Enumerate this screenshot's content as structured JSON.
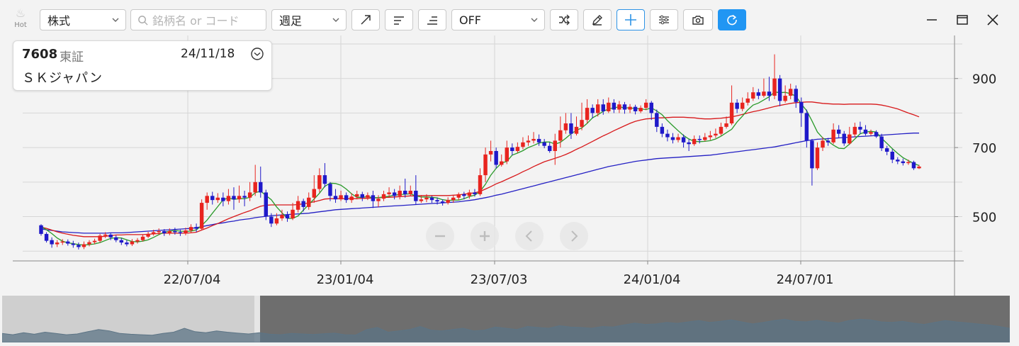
{
  "toolbar": {
    "hot_label": "Hot",
    "market_select": "株式",
    "search_placeholder": "銘柄名 or コード",
    "period_select": "週足",
    "indicator_select": "OFF",
    "icons": [
      "trend-line-icon",
      "horizontal-line-icon",
      "horizontal-line-end-icon",
      "shuffle-icon",
      "pencil-icon",
      "crosshair-plus-icon",
      "settings-sliders-icon",
      "camera-icon",
      "refresh-icon"
    ]
  },
  "window": {
    "controls": [
      "minimize-icon",
      "maximize-icon",
      "close-icon"
    ]
  },
  "info": {
    "code": "7608",
    "market": "東証",
    "date": "24/11/18",
    "name": "ＳＫジャパン"
  },
  "colors": {
    "up": "#e8241f",
    "down": "#1f19c9",
    "ma_short": "#2a9a2a",
    "ma_mid": "#d8191b",
    "ma_long": "#2420c4",
    "active_button": "#2196f3"
  },
  "chart_data": {
    "type": "candlestick",
    "title": "",
    "x_ticks": [
      "22/07/04",
      "23/01/04",
      "23/07/03",
      "24/01/04",
      "24/07/01"
    ],
    "y_ticks": [
      500,
      700,
      900
    ],
    "ylim": [
      380,
      1000
    ],
    "grid": true,
    "candles": [
      [
        475,
        450,
        478,
        445
      ],
      [
        450,
        430,
        455,
        425
      ],
      [
        432,
        420,
        440,
        410
      ],
      [
        420,
        425,
        432,
        412
      ],
      [
        425,
        428,
        435,
        418
      ],
      [
        428,
        422,
        434,
        416
      ],
      [
        422,
        418,
        430,
        410
      ],
      [
        418,
        412,
        425,
        405
      ],
      [
        412,
        420,
        428,
        406
      ],
      [
        420,
        426,
        432,
        414
      ],
      [
        426,
        430,
        436,
        420
      ],
      [
        430,
        445,
        450,
        425
      ],
      [
        445,
        448,
        455,
        438
      ],
      [
        448,
        440,
        452,
        432
      ],
      [
        440,
        432,
        446,
        426
      ],
      [
        432,
        425,
        438,
        418
      ],
      [
        425,
        420,
        432,
        414
      ],
      [
        420,
        428,
        435,
        415
      ],
      [
        428,
        432,
        438,
        422
      ],
      [
        432,
        442,
        448,
        428
      ],
      [
        442,
        450,
        456,
        438
      ],
      [
        450,
        455,
        462,
        445
      ],
      [
        455,
        458,
        466,
        448
      ],
      [
        458,
        452,
        464,
        444
      ],
      [
        452,
        458,
        466,
        446
      ],
      [
        458,
        455,
        468,
        448
      ],
      [
        455,
        452,
        462,
        444
      ],
      [
        452,
        460,
        468,
        446
      ],
      [
        460,
        470,
        478,
        452
      ],
      [
        470,
        465,
        480,
        455
      ],
      [
        465,
        540,
        550,
        460
      ],
      [
        540,
        560,
        570,
        520
      ],
      [
        560,
        548,
        572,
        535
      ],
      [
        548,
        555,
        568,
        540
      ],
      [
        555,
        545,
        570,
        530
      ],
      [
        545,
        560,
        580,
        535
      ],
      [
        560,
        550,
        585,
        520
      ],
      [
        550,
        560,
        590,
        540
      ],
      [
        560,
        555,
        575,
        530
      ],
      [
        555,
        570,
        600,
        545
      ],
      [
        570,
        600,
        650,
        560
      ],
      [
        600,
        570,
        645,
        555
      ],
      [
        570,
        500,
        578,
        490
      ],
      [
        500,
        480,
        510,
        470
      ],
      [
        480,
        495,
        510,
        475
      ],
      [
        495,
        505,
        520,
        488
      ],
      [
        505,
        495,
        515,
        485
      ],
      [
        495,
        520,
        540,
        490
      ],
      [
        520,
        545,
        560,
        512
      ],
      [
        545,
        528,
        552,
        515
      ],
      [
        528,
        555,
        570,
        520
      ],
      [
        555,
        580,
        620,
        540
      ],
      [
        580,
        620,
        640,
        570
      ],
      [
        620,
        595,
        655,
        585
      ],
      [
        595,
        560,
        600,
        545
      ],
      [
        560,
        550,
        580,
        540
      ],
      [
        550,
        562,
        575,
        545
      ],
      [
        562,
        548,
        570,
        540
      ],
      [
        548,
        558,
        568,
        540
      ],
      [
        558,
        565,
        575,
        550
      ],
      [
        565,
        555,
        572,
        545
      ],
      [
        555,
        562,
        570,
        548
      ],
      [
        562,
        545,
        575,
        525
      ],
      [
        545,
        552,
        562,
        528
      ],
      [
        552,
        565,
        575,
        545
      ],
      [
        565,
        570,
        585,
        555
      ],
      [
        570,
        560,
        580,
        550
      ],
      [
        560,
        575,
        590,
        550
      ],
      [
        575,
        565,
        610,
        555
      ],
      [
        565,
        575,
        590,
        560
      ],
      [
        575,
        545,
        620,
        535
      ],
      [
        545,
        550,
        560,
        540
      ],
      [
        550,
        555,
        565,
        542
      ],
      [
        555,
        548,
        560,
        540
      ],
      [
        548,
        544,
        555,
        535
      ],
      [
        544,
        540,
        550,
        532
      ],
      [
        540,
        548,
        556,
        535
      ],
      [
        548,
        555,
        562,
        540
      ],
      [
        555,
        565,
        570,
        548
      ],
      [
        565,
        560,
        572,
        550
      ],
      [
        560,
        570,
        578,
        552
      ],
      [
        570,
        565,
        580,
        558
      ],
      [
        565,
        620,
        640,
        560
      ],
      [
        620,
        680,
        700,
        600
      ],
      [
        680,
        690,
        720,
        660
      ],
      [
        690,
        650,
        700,
        640
      ],
      [
        650,
        660,
        680,
        645
      ],
      [
        660,
        700,
        720,
        652
      ],
      [
        700,
        690,
        712,
        678
      ],
      [
        690,
        702,
        715,
        685
      ],
      [
        702,
        715,
        730,
        695
      ],
      [
        715,
        720,
        735,
        705
      ],
      [
        720,
        725,
        745,
        712
      ],
      [
        725,
        715,
        738,
        705
      ],
      [
        715,
        705,
        725,
        698
      ],
      [
        705,
        690,
        715,
        685
      ],
      [
        690,
        720,
        740,
        650
      ],
      [
        720,
        750,
        790,
        700
      ],
      [
        750,
        770,
        800,
        740
      ],
      [
        770,
        740,
        800,
        725
      ],
      [
        740,
        760,
        790,
        735
      ],
      [
        760,
        780,
        830,
        750
      ],
      [
        780,
        815,
        840,
        770
      ],
      [
        815,
        800,
        825,
        785
      ],
      [
        800,
        825,
        840,
        790
      ],
      [
        825,
        805,
        840,
        795
      ],
      [
        805,
        830,
        845,
        800
      ],
      [
        830,
        810,
        840,
        800
      ],
      [
        810,
        825,
        835,
        800
      ],
      [
        825,
        810,
        832,
        798
      ],
      [
        810,
        818,
        826,
        800
      ],
      [
        818,
        805,
        824,
        796
      ],
      [
        805,
        815,
        822,
        800
      ],
      [
        815,
        830,
        840,
        808
      ],
      [
        830,
        800,
        835,
        780
      ],
      [
        800,
        760,
        810,
        745
      ],
      [
        760,
        740,
        770,
        730
      ],
      [
        740,
        730,
        752,
        718
      ],
      [
        730,
        722,
        742,
        712
      ],
      [
        722,
        730,
        740,
        715
      ],
      [
        730,
        715,
        738,
        700
      ],
      [
        715,
        710,
        724,
        690
      ],
      [
        710,
        725,
        735,
        705
      ],
      [
        725,
        722,
        735,
        712
      ],
      [
        722,
        730,
        742,
        718
      ],
      [
        730,
        735,
        748,
        722
      ],
      [
        735,
        740,
        755,
        728
      ],
      [
        740,
        760,
        772,
        735
      ],
      [
        760,
        770,
        790,
        755
      ],
      [
        770,
        830,
        880,
        765
      ],
      [
        830,
        812,
        840,
        800
      ],
      [
        812,
        830,
        845,
        805
      ],
      [
        830,
        842,
        860,
        822
      ],
      [
        842,
        860,
        875,
        835
      ],
      [
        860,
        850,
        870,
        840
      ],
      [
        850,
        862,
        900,
        845
      ],
      [
        862,
        850,
        905,
        835
      ],
      [
        850,
        900,
        970,
        840
      ],
      [
        900,
        835,
        910,
        820
      ],
      [
        835,
        850,
        880,
        830
      ],
      [
        850,
        870,
        885,
        840
      ],
      [
        870,
        832,
        880,
        815
      ],
      [
        832,
        800,
        845,
        760
      ],
      [
        800,
        720,
        810,
        700
      ],
      [
        720,
        640,
        725,
        590
      ],
      [
        640,
        700,
        715,
        635
      ],
      [
        700,
        720,
        730,
        690
      ],
      [
        720,
        715,
        728,
        705
      ],
      [
        715,
        752,
        770,
        710
      ],
      [
        752,
        740,
        765,
        728
      ],
      [
        740,
        712,
        748,
        705
      ],
      [
        712,
        738,
        760,
        708
      ],
      [
        738,
        760,
        772,
        730
      ],
      [
        760,
        752,
        775,
        740
      ],
      [
        752,
        740,
        765,
        735
      ],
      [
        740,
        745,
        752,
        735
      ],
      [
        745,
        732,
        750,
        728
      ],
      [
        732,
        698,
        740,
        690
      ],
      [
        698,
        688,
        705,
        678
      ],
      [
        688,
        665,
        695,
        655
      ],
      [
        665,
        660,
        672,
        652
      ],
      [
        660,
        655,
        668,
        648
      ],
      [
        655,
        658,
        665,
        650
      ],
      [
        658,
        640,
        662,
        635
      ],
      [
        640,
        645,
        650,
        638
      ]
    ],
    "ma_short": [
      471,
      462,
      451,
      438,
      429,
      424,
      422,
      419,
      418,
      419,
      421,
      425,
      431,
      437,
      439,
      438,
      433,
      428,
      427,
      429,
      433,
      440,
      448,
      455,
      458,
      460,
      458,
      457,
      458,
      462,
      474,
      490,
      510,
      529,
      549,
      554,
      550,
      552,
      552,
      556,
      569,
      574,
      561,
      549,
      528,
      511,
      495,
      495,
      502,
      519,
      535,
      551,
      568,
      588,
      597,
      596,
      591,
      580,
      566,
      556,
      556,
      558,
      555,
      555,
      557,
      559,
      562,
      564,
      565,
      566,
      560,
      557,
      557,
      556,
      554,
      549,
      547,
      548,
      548,
      552,
      558,
      562,
      573,
      594,
      620,
      640,
      655,
      660,
      678,
      684,
      691,
      700,
      706,
      713,
      716,
      716,
      710,
      715,
      727,
      740,
      750,
      757,
      770,
      786,
      795,
      805,
      812,
      815,
      818,
      815,
      815,
      813,
      812,
      810,
      815,
      806,
      795,
      778,
      763,
      749,
      735,
      725,
      718,
      717,
      718,
      720,
      725,
      733,
      743,
      753,
      774,
      791,
      809,
      823,
      829,
      838,
      847,
      861,
      859,
      860,
      856,
      849,
      826,
      807,
      777,
      745,
      728,
      718,
      707,
      698,
      697,
      710,
      725,
      740,
      745,
      747,
      745,
      727,
      712,
      697,
      683,
      671,
      662,
      654,
      648
    ],
    "ma_mid": [
      470,
      466,
      461,
      456,
      452,
      449,
      446,
      444,
      442,
      442,
      442,
      442,
      443,
      445,
      447,
      447,
      448,
      448,
      448,
      448,
      449,
      450,
      451,
      452,
      452,
      452,
      452,
      452,
      453,
      455,
      461,
      467,
      474,
      480,
      487,
      494,
      500,
      506,
      512,
      517,
      524,
      530,
      533,
      534,
      534,
      534,
      534,
      534,
      535,
      537,
      540,
      543,
      547,
      551,
      552,
      552,
      552,
      552,
      552,
      552,
      553,
      553,
      554,
      555,
      556,
      556,
      557,
      558,
      559,
      560,
      560,
      561,
      561,
      561,
      561,
      561,
      561,
      562,
      563,
      565,
      567,
      569,
      573,
      580,
      587,
      595,
      601,
      608,
      615,
      622,
      630,
      637,
      645,
      652,
      659,
      664,
      669,
      674,
      680,
      687,
      695,
      702,
      710,
      718,
      726,
      734,
      741,
      749,
      756,
      763,
      770,
      776,
      780,
      783,
      784,
      786,
      786,
      787,
      788,
      788,
      788,
      787,
      786,
      784,
      783,
      783,
      784,
      785,
      787,
      789,
      792,
      796,
      800,
      804,
      807,
      811,
      815,
      819,
      822,
      825,
      828,
      830,
      831,
      832,
      832,
      830,
      828,
      827,
      826,
      826,
      825,
      826,
      826,
      826,
      826,
      826,
      825,
      823,
      820,
      816,
      812,
      806,
      800,
      795,
      789
    ],
    "ma_long": [
      465,
      462,
      460,
      458,
      456,
      455,
      454,
      453,
      452,
      452,
      452,
      452,
      452,
      453,
      453,
      453,
      454,
      455,
      456,
      457,
      458,
      459,
      460,
      461,
      462,
      463,
      464,
      465,
      466,
      468,
      471,
      474,
      477,
      480,
      482,
      485,
      487,
      490,
      492,
      494,
      497,
      499,
      501,
      503,
      504,
      505,
      506,
      507,
      508,
      509,
      510,
      512,
      514,
      516,
      518,
      520,
      521,
      522,
      523,
      524,
      525,
      526,
      527,
      528,
      529,
      530,
      531,
      532,
      533,
      534,
      535,
      536,
      537,
      538,
      539,
      540,
      541,
      542,
      543,
      545,
      547,
      549,
      552,
      555,
      558,
      562,
      565,
      569,
      573,
      577,
      581,
      585,
      589,
      593,
      597,
      601,
      605,
      609,
      613,
      617,
      621,
      625,
      629,
      633,
      637,
      641,
      645,
      648,
      651,
      654,
      657,
      660,
      662,
      664,
      666,
      668,
      669,
      670,
      671,
      672,
      673,
      674,
      675,
      676,
      677,
      678,
      680,
      682,
      684,
      686,
      688,
      690,
      692,
      694,
      696,
      698,
      700,
      702,
      705,
      708,
      711,
      714,
      717,
      720,
      722,
      724,
      725,
      726,
      727,
      728,
      729,
      730,
      731,
      732,
      733,
      734,
      735,
      736,
      737,
      738,
      739,
      740,
      741,
      742,
      742
    ],
    "volume_profile": [
      0.35,
      0.3,
      0.38,
      0.32,
      0.4,
      0.35,
      0.3,
      0.33,
      0.42,
      0.5,
      0.45,
      0.35,
      0.32,
      0.3,
      0.28,
      0.35,
      0.4,
      0.55,
      0.42,
      0.38,
      0.45,
      0.4,
      0.36,
      0.33,
      0.38,
      0.32,
      0.3,
      0.35,
      0.33,
      0.31,
      0.34,
      0.36,
      0.3,
      0.29,
      0.5,
      0.58,
      0.4,
      0.45,
      0.5,
      0.62,
      0.48,
      0.45,
      0.5,
      0.55,
      0.45,
      0.48,
      0.6,
      0.55,
      0.5,
      0.62,
      0.58,
      0.55,
      0.65,
      0.6,
      0.58,
      0.55,
      0.62,
      0.6,
      0.68,
      0.75,
      0.7,
      0.72,
      0.78,
      0.74,
      0.8,
      0.85,
      0.78,
      0.82,
      0.88,
      0.8,
      0.72,
      0.78,
      0.85,
      0.9,
      0.82,
      0.8,
      0.86,
      0.8,
      0.75,
      0.85,
      0.9,
      0.88,
      0.8,
      0.78,
      0.82,
      0.75,
      0.7,
      0.78,
      0.85,
      0.8,
      0.76,
      0.72,
      0.68,
      0.62,
      0.55
    ]
  }
}
